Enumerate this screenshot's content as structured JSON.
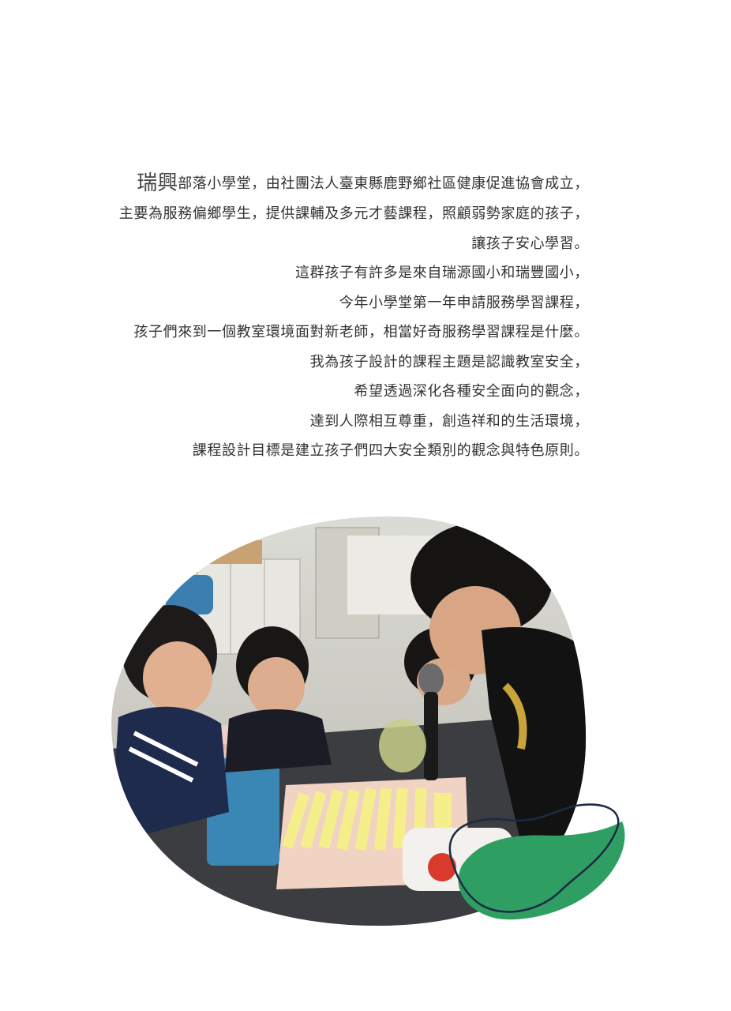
{
  "article": {
    "lead_word": "瑞興",
    "lines": [
      "部落小學堂，由社團法人臺東縣鹿野鄉社區健康促進協會成立，",
      "主要為服務偏鄉學生，提供課輔及多元才藝課程，照顧弱勢家庭的孩子，",
      "讓孩子安心學習。",
      "這群孩子有許多是來自瑞源國小和瑞豐國小，",
      "今年小學堂第一年申請服務學習課程，",
      "孩子們來到一個教室環境面對新老師，相當好奇服務學習課程是什麼。",
      "我為孩子設計的課程主題是認識教室安全，",
      "希望透過深化各種安全面向的觀念，",
      "達到人際相互尊重，創造祥和的生活環境，",
      "課程設計目標是建立孩子們四大安全類別的觀念與特色原則。"
    ]
  },
  "colors": {
    "text": "#333333",
    "accent_green": "#2f9e63",
    "outline_navy": "#1c2a44"
  }
}
